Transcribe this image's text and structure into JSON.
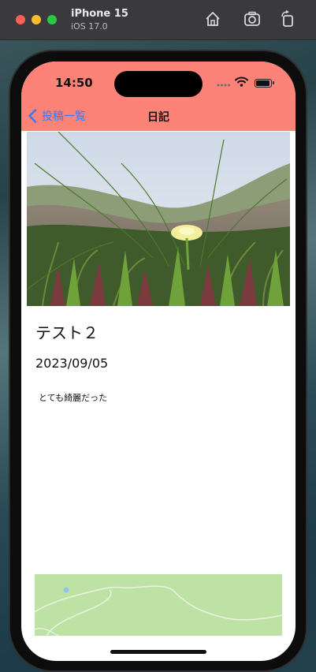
{
  "simulator": {
    "device_name": "iPhone 15",
    "os_version": "iOS 17.0",
    "buttons": {
      "home_icon": "home-icon",
      "screenshot_icon": "camera-icon",
      "rotate_icon": "rotate-icon"
    }
  },
  "status_bar": {
    "time": "14:50"
  },
  "nav_bar": {
    "back_label": "投稿一覧",
    "title": "日記"
  },
  "post": {
    "title": "テスト２",
    "date": "2023/09/05",
    "body": "とても綺麗だった"
  },
  "colors": {
    "header": "#fd8379",
    "link": "#3478f6",
    "map_land": "#bde2a4"
  }
}
